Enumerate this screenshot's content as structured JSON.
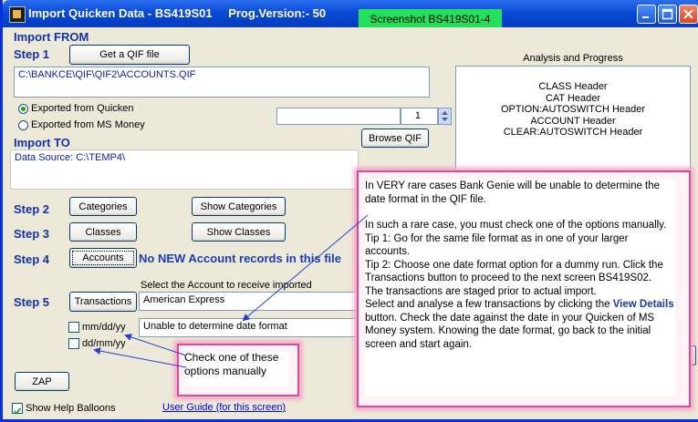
{
  "window": {
    "title_app": "Import Quicken Data - BS419S01",
    "title_version": "Prog.Version:-  50",
    "screenshot_badge": "Screenshot BS419S01-4"
  },
  "import_from": {
    "heading": "Import FROM",
    "step1": "Step 1",
    "get_qif_button": "Get a QIF file",
    "qif_path": "C:\\BANKCE\\QIF\\QIF2\\ACCOUNTS.QIF",
    "radio_quicken": "Exported from Quicken",
    "radio_msmoney": "Exported from MS Money",
    "count_value": "1",
    "browse_button": "Browse  QIF"
  },
  "import_to": {
    "heading": "Import TO",
    "data_source": "Data Source: C:\\TEMP4\\"
  },
  "steps": {
    "step2": "Step 2",
    "categories_button": "Categories",
    "show_categories_button": "Show Categories",
    "step3": "Step 3",
    "classes_button": "Classes",
    "show_classes_button": "Show Classes",
    "step4": "Step 4",
    "accounts_button": "Accounts",
    "accounts_message": "No NEW Account records in this file",
    "step5": "Step 5",
    "transactions_button": "Transactions",
    "select_account_label": "Select  the Account to receive imported",
    "account_value": "American Express",
    "date_status": "Unable to determine date format",
    "opt_mmddyy": "mm/dd/yy",
    "opt_ddmmyy": "dd/mm/yy",
    "zap_button": "ZAP"
  },
  "analysis": {
    "title": "Analysis and Progress",
    "lines": [
      "CLASS Header",
      "CAT Header",
      "OPTION:AUTOSWITCH Header",
      "ACCOUNT Header",
      "CLEAR:AUTOSWITCH Header"
    ]
  },
  "footer": {
    "show_help": "Show Help Balloons",
    "user_guide": "User Guide (for this screen)"
  },
  "help_callout": {
    "p1": "In VERY rare cases Bank Genie will be unable to determine the date format in the QIF file.",
    "p2": "In such a rare case, you must check one of the options manually.",
    "p3": "Tip 1: Go for the same file format as in one of your larger accounts.",
    "p4": "Tip 2: Choose one date format option for a dummy run. Click the Transactions button to proceed to the next screen BS419S02.",
    "p5": "The transactions are staged prior to actual import.",
    "p6a": "Select and analyse a few transactions by clicking the",
    "p6_bold": "View Details",
    "p6b": "button. Check the date against the date in your Quicken of MS Money system. Knowing the date format, go back to the initial screen and start again."
  },
  "small_callout": {
    "text": "Check one of these options manually"
  },
  "colors": {
    "titlebar": "#0a4bd6",
    "section_heading": "#1432a8",
    "callout_border": "#e0489a",
    "badge": "#22e05a"
  }
}
